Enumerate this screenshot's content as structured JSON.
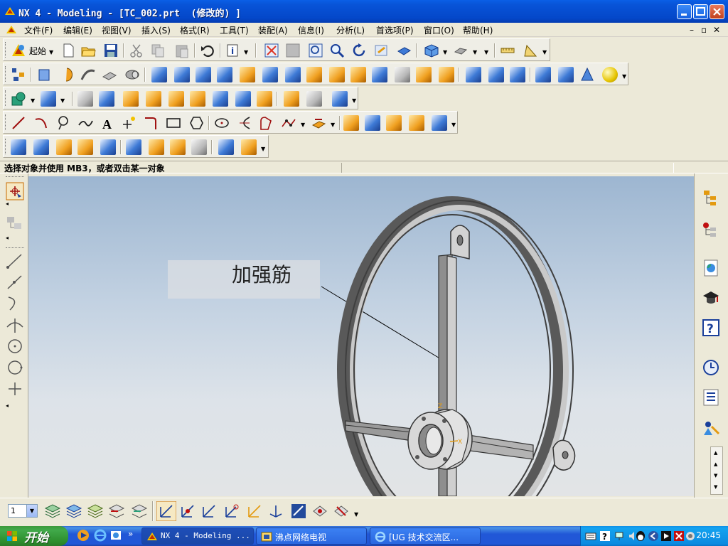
{
  "window": {
    "title": "NX 4 - Modeling - [TC_002.prt  (修改的) ]"
  },
  "menu": {
    "items": [
      "文件(F)",
      "编辑(E)",
      "视图(V)",
      "插入(S)",
      "格式(R)",
      "工具(T)",
      "装配(A)",
      "信息(I)",
      "分析(L)",
      "首选项(P)",
      "窗口(O)",
      "帮助(H)"
    ],
    "doc_controls": [
      "–",
      "▫",
      "✕"
    ]
  },
  "toolbar": {
    "start_label": "起始"
  },
  "status": {
    "prompt": "选择对象并使用 MB3，或者双击某一对象"
  },
  "viewport": {
    "annotation": "加强筋",
    "triad": {
      "z": "Z",
      "x": "X"
    }
  },
  "bottom": {
    "layer_value": "1"
  },
  "taskbar": {
    "start_label": "开始",
    "quick_more": "»",
    "tasks": [
      {
        "label": "NX 4 - Modeling ...",
        "icon": "nx-icon"
      },
      {
        "label": "沸点网络电视",
        "icon": "tv-icon"
      },
      {
        "label": "[UG 技术交流区...",
        "icon": "ie-icon"
      }
    ],
    "clock": "20:45"
  },
  "colors": {
    "titlebar": "#0854d8",
    "taskbar": "#2157d7",
    "start": "#3c9a3c",
    "viewport_top": "#9db6d1",
    "viewport_bottom": "#e2e4e6"
  }
}
